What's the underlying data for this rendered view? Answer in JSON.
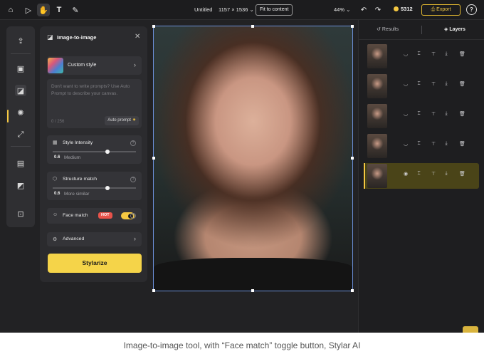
{
  "topbar": {
    "doc_title": "Untitled",
    "dimensions": "1157 × 1536",
    "fit_label": "Fit to content",
    "zoom": "44%",
    "credits": "5312",
    "export_label": "Export",
    "help_label": "?",
    "icons": [
      "home-icon",
      "select-arrow-icon",
      "hand-icon",
      "text-icon",
      "pen-icon"
    ]
  },
  "left_toolbar": {
    "icons": [
      "upload-icon",
      "ai-image-icon",
      "image-to-image-icon",
      "enhance-icon",
      "expand-icon",
      "text-to-image-icon",
      "edit-image-icon",
      "crop-icon"
    ]
  },
  "panel": {
    "title": "Image-to-image",
    "close_label": "✕",
    "custom_style": "Custom style",
    "prompt_placeholder": "Don't want to write prompts? Use Auto Prompt to describe  your canvas.",
    "prompt_count": "0 / 256",
    "auto_prompt": "Auto prompt",
    "style_intensity": {
      "label": "Style Intensity",
      "value": "0.6",
      "level": "Medium",
      "fraction": 0.66
    },
    "structure_match": {
      "label": "Structure match",
      "value": "0.6",
      "level": "More similar",
      "fraction": 0.66
    },
    "face_match": {
      "label": "Face match",
      "badge": "HOT",
      "enabled": true
    },
    "advanced": "Advanced",
    "advanced_chevron": "›",
    "stylize_label": "Stylarize"
  },
  "right_panel": {
    "tabs": [
      {
        "label": "Results"
      },
      {
        "label": "Layers"
      }
    ],
    "active_tab": "Layers",
    "layers_count": 5,
    "selected_layer": 4,
    "layer_icons": [
      "visibility-icon",
      "align-center-icon",
      "align-top-icon",
      "download-icon",
      "delete-icon"
    ]
  },
  "colors": {
    "accent": "#f5c842",
    "background": "#222224",
    "panel": "#2b2b2e",
    "selection": "#6b8fd8",
    "hot_badge": "#e8524a"
  },
  "caption": "Image-to-image tool, with “Face match” toggle button, Stylar AI"
}
